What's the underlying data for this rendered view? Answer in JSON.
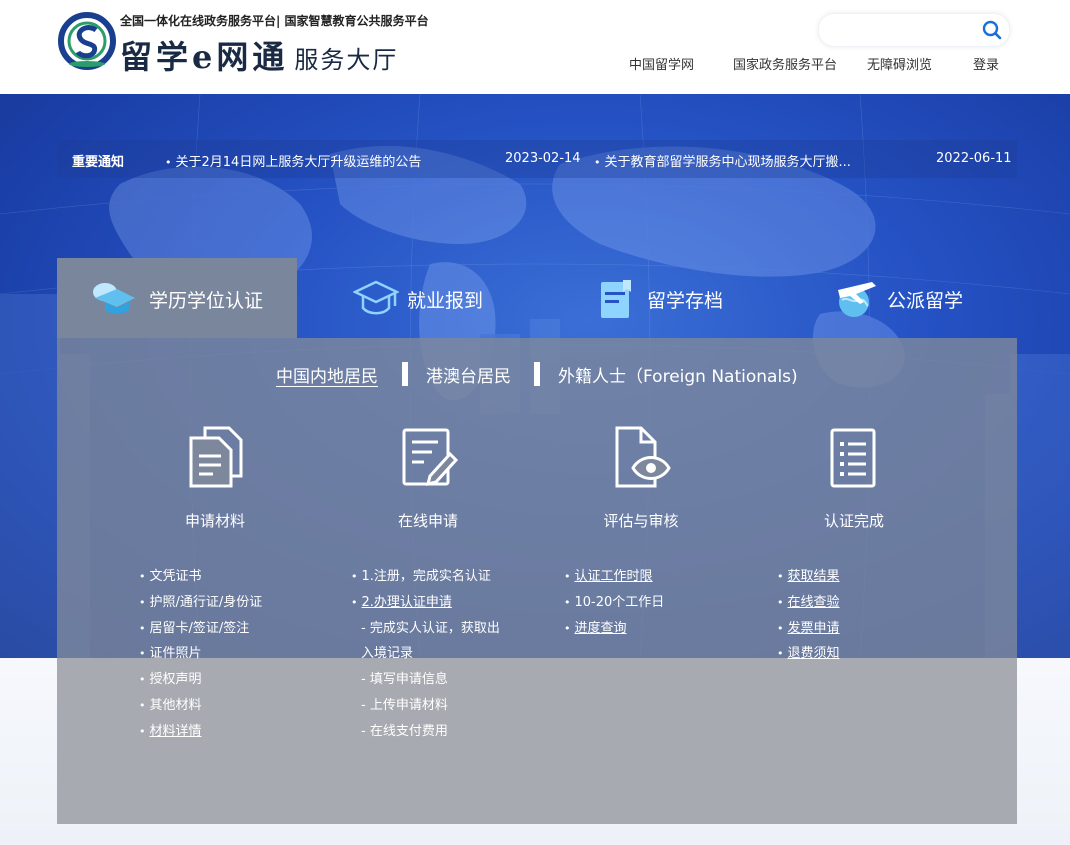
{
  "header": {
    "tagline": "全国一体化在线政务服务平台| 国家智慧教育公共服务平台",
    "brand": "留学e网通",
    "brand_suffix": "服务大厅",
    "search": {
      "placeholder": "",
      "value": ""
    },
    "nav": [
      "中国留学网",
      "国家政务服务平台",
      "无障碍浏览",
      "登录"
    ]
  },
  "notice": {
    "label": "重要通知",
    "items": [
      {
        "text": "关于2月14日网上服务大厅升级运维的公告",
        "date": "2023-02-14"
      },
      {
        "text": "关于教育部留学服务中心现场服务大厅搬...",
        "date": "2022-06-11"
      }
    ]
  },
  "tabs": [
    {
      "label": "学历学位认证",
      "icon": "graduation-cap-icon",
      "active": true
    },
    {
      "label": "就业报到",
      "icon": "mortarboard-icon",
      "active": false
    },
    {
      "label": "留学存档",
      "icon": "archive-folder-icon",
      "active": false
    },
    {
      "label": "公派留学",
      "icon": "globe-airplane-icon",
      "active": false
    }
  ],
  "sub_tabs": [
    "中国内地居民",
    "港澳台居民",
    "外籍人士（Foreign Nationals)"
  ],
  "steps": [
    {
      "label": "申请材料",
      "icon": "documents-icon"
    },
    {
      "label": "在线申请",
      "icon": "form-edit-icon"
    },
    {
      "label": "评估与审核",
      "icon": "document-eye-icon"
    },
    {
      "label": "认证完成",
      "icon": "checklist-icon"
    }
  ],
  "columns": {
    "materials": [
      "文凭证书",
      "护照/通行证/身份证",
      "居留卡/签证/签注",
      "证件照片",
      "授权声明",
      "其他材料",
      "材料详情"
    ],
    "apply": [
      "1.注册，完成实名认证",
      "2.办理认证申请",
      "- 完成实人认证，获取出",
      "入境记录",
      "- 填写申请信息",
      "- 上传申请材料",
      "- 在线支付费用"
    ],
    "review": [
      "认证工作时限",
      "10-20个工作日",
      "进度查询"
    ],
    "done": [
      "获取结果",
      "在线查验",
      "发票申请",
      "退费须知"
    ]
  },
  "colors": {
    "hero_blue": "#2552c4",
    "panel_gray": "#7d889c",
    "accent": "#1a73e8"
  }
}
